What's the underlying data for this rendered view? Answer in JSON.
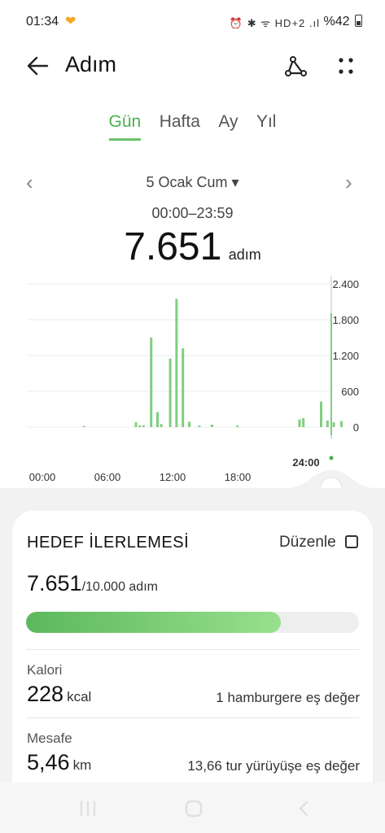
{
  "status_bar": {
    "time": "01:34",
    "heart_icon": "heart-app-icon",
    "indicators": "⏰ ✱ ᯤ HD+2 .ıl",
    "battery": "%42"
  },
  "header": {
    "title": "Adım",
    "back_icon": "arrow-left-icon",
    "share_icon": "share-icon",
    "more_icon": "more-dots-icon"
  },
  "tabs": [
    {
      "label": "Gün",
      "active": true
    },
    {
      "label": "Hafta",
      "active": false
    },
    {
      "label": "Ay",
      "active": false
    },
    {
      "label": "Yıl",
      "active": false
    }
  ],
  "date_nav": {
    "date_label": "5 Ocak Cum ▾",
    "range": "00:00–23:59"
  },
  "summary": {
    "steps": "7.651",
    "unit": "adım"
  },
  "chart_data": {
    "type": "bar",
    "x_tick_labels": [
      "00:00",
      "06:00",
      "12:00",
      "18:00",
      "24:00"
    ],
    "y_tick_labels": [
      "2.400",
      "1.800",
      "1.200",
      "600",
      "0"
    ],
    "ylim": [
      0,
      2400
    ],
    "xlim_hours": [
      0,
      24
    ],
    "grid": true,
    "bar_color": "#7fcf7f",
    "bars": [
      {
        "hour": 4.5,
        "value": 20
      },
      {
        "hour": 8.6,
        "value": 80
      },
      {
        "hour": 8.9,
        "value": 30
      },
      {
        "hour": 9.2,
        "value": 30
      },
      {
        "hour": 9.8,
        "value": 1500
      },
      {
        "hour": 10.3,
        "value": 250
      },
      {
        "hour": 10.6,
        "value": 50
      },
      {
        "hour": 11.3,
        "value": 1150
      },
      {
        "hour": 11.8,
        "value": 2150
      },
      {
        "hour": 12.3,
        "value": 1320
      },
      {
        "hour": 12.8,
        "value": 90
      },
      {
        "hour": 13.6,
        "value": 25
      },
      {
        "hour": 14.6,
        "value": 40
      },
      {
        "hour": 16.6,
        "value": 25
      },
      {
        "hour": 21.5,
        "value": 130
      },
      {
        "hour": 21.8,
        "value": 150
      },
      {
        "hour": 23.2,
        "value": 430
      },
      {
        "hour": 23.7,
        "value": 110
      },
      {
        "hour": 24.2,
        "value": 80
      },
      {
        "hour": 24.8,
        "value": 100
      }
    ]
  },
  "goal_card": {
    "title": "HEDEF İLERLEMESİ",
    "edit_label": "Düzenle",
    "current": "7.651",
    "goal_text": "/10.000 adım",
    "progress_fraction": 0.7651,
    "accent": "#6cc36c"
  },
  "metrics": [
    {
      "label": "Kalori",
      "value": "228",
      "unit": "kcal",
      "equivalent": "1 hamburgere eş değer"
    },
    {
      "label": "Mesafe",
      "value": "5,46",
      "unit": "km",
      "equivalent": "13,66 tur yürüyüşe eş değer"
    }
  ],
  "nav_bar": {
    "recents_icon": "recents-icon",
    "home_icon": "home-icon",
    "back_icon": "back-chevron-icon"
  }
}
